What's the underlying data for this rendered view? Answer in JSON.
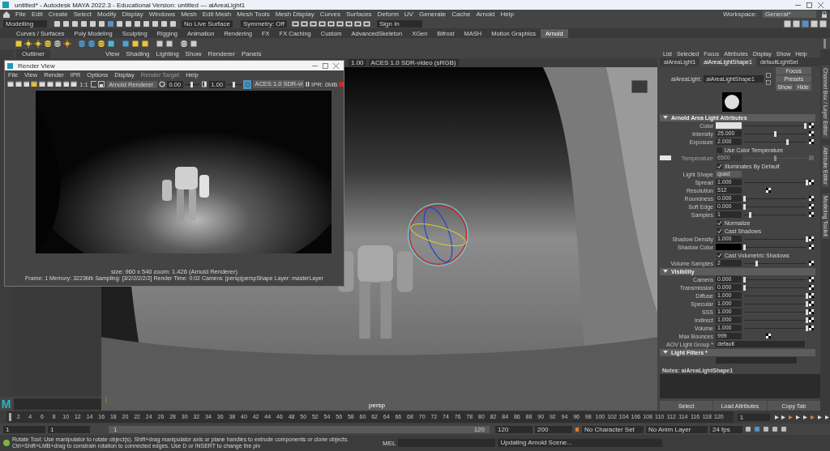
{
  "window": {
    "title": "untitled* - Autodesk MAYA 2022.3 - Educational Version: untitled  ---  aiAreaLight1"
  },
  "menu_bar": {
    "items": [
      "File",
      "Edit",
      "Create",
      "Select",
      "Modify",
      "Display",
      "Windows",
      "Mesh",
      "Edit Mesh",
      "Mesh Tools",
      "Mesh Display",
      "Curves",
      "Surfaces",
      "Deform",
      "UV",
      "Generate",
      "Cache",
      "Arnold",
      "Help"
    ],
    "workspace_label": "Workspace:",
    "workspace": "General*"
  },
  "status_line": {
    "mode": "Modelling",
    "live_surface": "No Live Surface",
    "symmetry": "Symmetry: Off",
    "sign_in": "Sign In"
  },
  "shelf": {
    "tabs": [
      {
        "label": "Curves / Surfaces",
        "selected": false
      },
      {
        "label": "Poly Modeling",
        "selected": false
      },
      {
        "label": "Sculpting",
        "selected": false
      },
      {
        "label": "Rigging",
        "selected": false
      },
      {
        "label": "Animation",
        "selected": false
      },
      {
        "label": "Rendering",
        "selected": false
      },
      {
        "label": "FX",
        "selected": false
      },
      {
        "label": "FX Caching",
        "selected": false
      },
      {
        "label": "Custom",
        "selected": false
      },
      {
        "label": "AdvancedSkeleton",
        "selected": false
      },
      {
        "label": "XGen",
        "selected": false
      },
      {
        "label": "Bifrost",
        "selected": false
      },
      {
        "label": "MASH",
        "selected": false
      },
      {
        "label": "Motion Graphics",
        "selected": false
      },
      {
        "label": "Arnold",
        "selected": true
      }
    ]
  },
  "outliner": {
    "title": "Outliner"
  },
  "viewport": {
    "menu": [
      "View",
      "Shading",
      "Lighting",
      "Show",
      "Renderer",
      "Panels"
    ],
    "gamma": "1.00",
    "color_space": "ACES 1.0 SDR-video (sRGB)",
    "camera": "persp"
  },
  "render_view": {
    "title": "Render View",
    "menu": [
      {
        "label": "File",
        "disabled": false
      },
      {
        "label": "View",
        "disabled": false
      },
      {
        "label": "Render",
        "disabled": false
      },
      {
        "label": "IPR",
        "disabled": false
      },
      {
        "label": "Options",
        "disabled": false
      },
      {
        "label": "Display",
        "disabled": false
      },
      {
        "label": "Render Target",
        "disabled": true
      },
      {
        "label": "Help",
        "disabled": false
      }
    ],
    "one_to_one": "1:1",
    "renderer": "Arnold Renderer",
    "exposure": {
      "value": "0.00",
      "level": 0.5
    },
    "gamma": {
      "value": "1.00",
      "level": 0.5
    },
    "color_space": "ACES 1.0 SDR-vi",
    "ipr": "IPR: 0MB",
    "info": "size: 960 x 540 zoom: 1.426    (Arnold Renderer)",
    "stats": "Frame: 1   Memory: 3223Mb   Sampling: [3/2/2/2/2/2]   Render Time: 0:02   Camera: |persp|perspShape   Layer: masterLayer"
  },
  "attribute_editor": {
    "menu": [
      "List",
      "Selected",
      "Focus",
      "Attributes",
      "Display",
      "Show",
      "Help"
    ],
    "tabs": [
      {
        "label": "aiAreaLight1",
        "selected": false
      },
      {
        "label": "aiAreaLightShape1",
        "selected": true
      },
      {
        "label": "defaultLightSet",
        "selected": false
      }
    ],
    "node_label": "aiAreaLight:",
    "node_name": "aiAreaLightShape1",
    "buttons": [
      "Focus",
      "Presets",
      "Show",
      "Hide"
    ],
    "sections": [
      {
        "title": "Arnold Area Light Attributes",
        "expanded": true,
        "rows": [
          {
            "kind": "color",
            "label": "Color",
            "color": "#e2e2e2",
            "level": 0.98
          },
          {
            "kind": "slider",
            "label": "Intensity",
            "value": "25.000",
            "level": 0.5
          },
          {
            "kind": "slider",
            "label": "Exposure",
            "value": "2.000",
            "level": 0.7
          },
          {
            "kind": "checkbox",
            "label": "Use Color Temperature",
            "checked": false
          },
          {
            "kind": "temperature",
            "label": "Temperature",
            "value": "6500",
            "color": "#e6e6e6",
            "level": 0.5
          },
          {
            "kind": "checkbox",
            "label": "Illuminates By Default",
            "checked": true
          },
          {
            "kind": "dropdown",
            "label": "Light Shape",
            "value": "quad"
          },
          {
            "kind": "slider",
            "label": "Spread",
            "value": "1.000",
            "level": 1
          },
          {
            "kind": "number",
            "label": "Resolution",
            "value": "512"
          },
          {
            "kind": "slider",
            "label": "Roundness",
            "value": "0.000",
            "level": 0
          },
          {
            "kind": "slider",
            "label": "Soft Edge",
            "value": "0.000",
            "level": 0
          },
          {
            "kind": "slider",
            "label": "Samples",
            "value": "1",
            "level": 0.1
          },
          {
            "kind": "checkbox",
            "label": "Normalize",
            "checked": true
          },
          {
            "kind": "checkbox",
            "label": "Cast Shadows",
            "checked": true
          },
          {
            "kind": "slider",
            "label": "Shadow Density",
            "value": "1.000",
            "level": 1
          },
          {
            "kind": "color",
            "label": "Shadow Color",
            "color": "#000000",
            "level": 0
          },
          {
            "kind": "checkbox",
            "label": "Cast Volumetric Shadows",
            "checked": true
          },
          {
            "kind": "slider",
            "label": "Volume Samples",
            "value": "2",
            "level": 0.2
          }
        ]
      },
      {
        "title": "Visibility",
        "expanded": true,
        "rows": [
          {
            "kind": "slider",
            "label": "Camera",
            "value": "0.000",
            "level": 0
          },
          {
            "kind": "slider",
            "label": "Transmission",
            "value": "0.000",
            "level": 0
          },
          {
            "kind": "slider",
            "label": "Diffuse",
            "value": "1.000",
            "level": 1
          },
          {
            "kind": "slider",
            "label": "Specular",
            "value": "1.000",
            "level": 1
          },
          {
            "kind": "slider",
            "label": "SSS",
            "value": "1.000",
            "level": 1
          },
          {
            "kind": "slider",
            "label": "Indirect",
            "value": "1.000",
            "level": 1
          },
          {
            "kind": "slider",
            "label": "Volume",
            "value": "1.000",
            "level": 1
          },
          {
            "kind": "number",
            "label": "Max Bounces",
            "value": "999"
          },
          {
            "kind": "text",
            "label": "AOV Light Group *",
            "value": "default"
          }
        ]
      },
      {
        "title": "Light Filters *",
        "expanded": true
      }
    ],
    "notes_label": "Notes:  aiAreaLightShape1",
    "footer_buttons": [
      "Select",
      "Load Attributes",
      "Copy Tab"
    ]
  },
  "side_tabs": [
    "Channel Box / Layer Editor",
    "Attribute Editor",
    "Modeling Toolkit"
  ],
  "logo": "M",
  "timeline": {
    "ticks": [
      "2",
      "4",
      "6",
      "8",
      "10",
      "12",
      "14",
      "16",
      "18",
      "20",
      "22",
      "24",
      "26",
      "28",
      "30",
      "32",
      "34",
      "36",
      "38",
      "40",
      "42",
      "44",
      "46",
      "48",
      "50",
      "52",
      "54",
      "56",
      "58",
      "60",
      "62",
      "64",
      "66",
      "68",
      "70",
      "72",
      "74",
      "76",
      "78",
      "80",
      "82",
      "84",
      "86",
      "88",
      "90",
      "92",
      "94",
      "96",
      "98",
      "100",
      "102",
      "104",
      "106",
      "108",
      "110",
      "112",
      "114",
      "116",
      "118",
      "120"
    ],
    "current_frame": "1"
  },
  "range_slider": {
    "start": "1",
    "playback_start": "1",
    "range_start": "1",
    "range_end": "120",
    "playback_end": "120",
    "end": "200",
    "character_set": "No Character Set",
    "anim_layer": "No Anim Layer",
    "fps": "24 fps"
  },
  "command_line": {
    "help": "Rotate Tool: Use manipulator to rotate object(s). Shift+drag manipulator axis or plane handles to extrude components or clone objects. Ctrl+Shift+LMB+drag to constrain rotation to connected edges. Use D or INSERT to change the piv",
    "language": "MEL",
    "status": "Updating Arnold Scene..."
  }
}
